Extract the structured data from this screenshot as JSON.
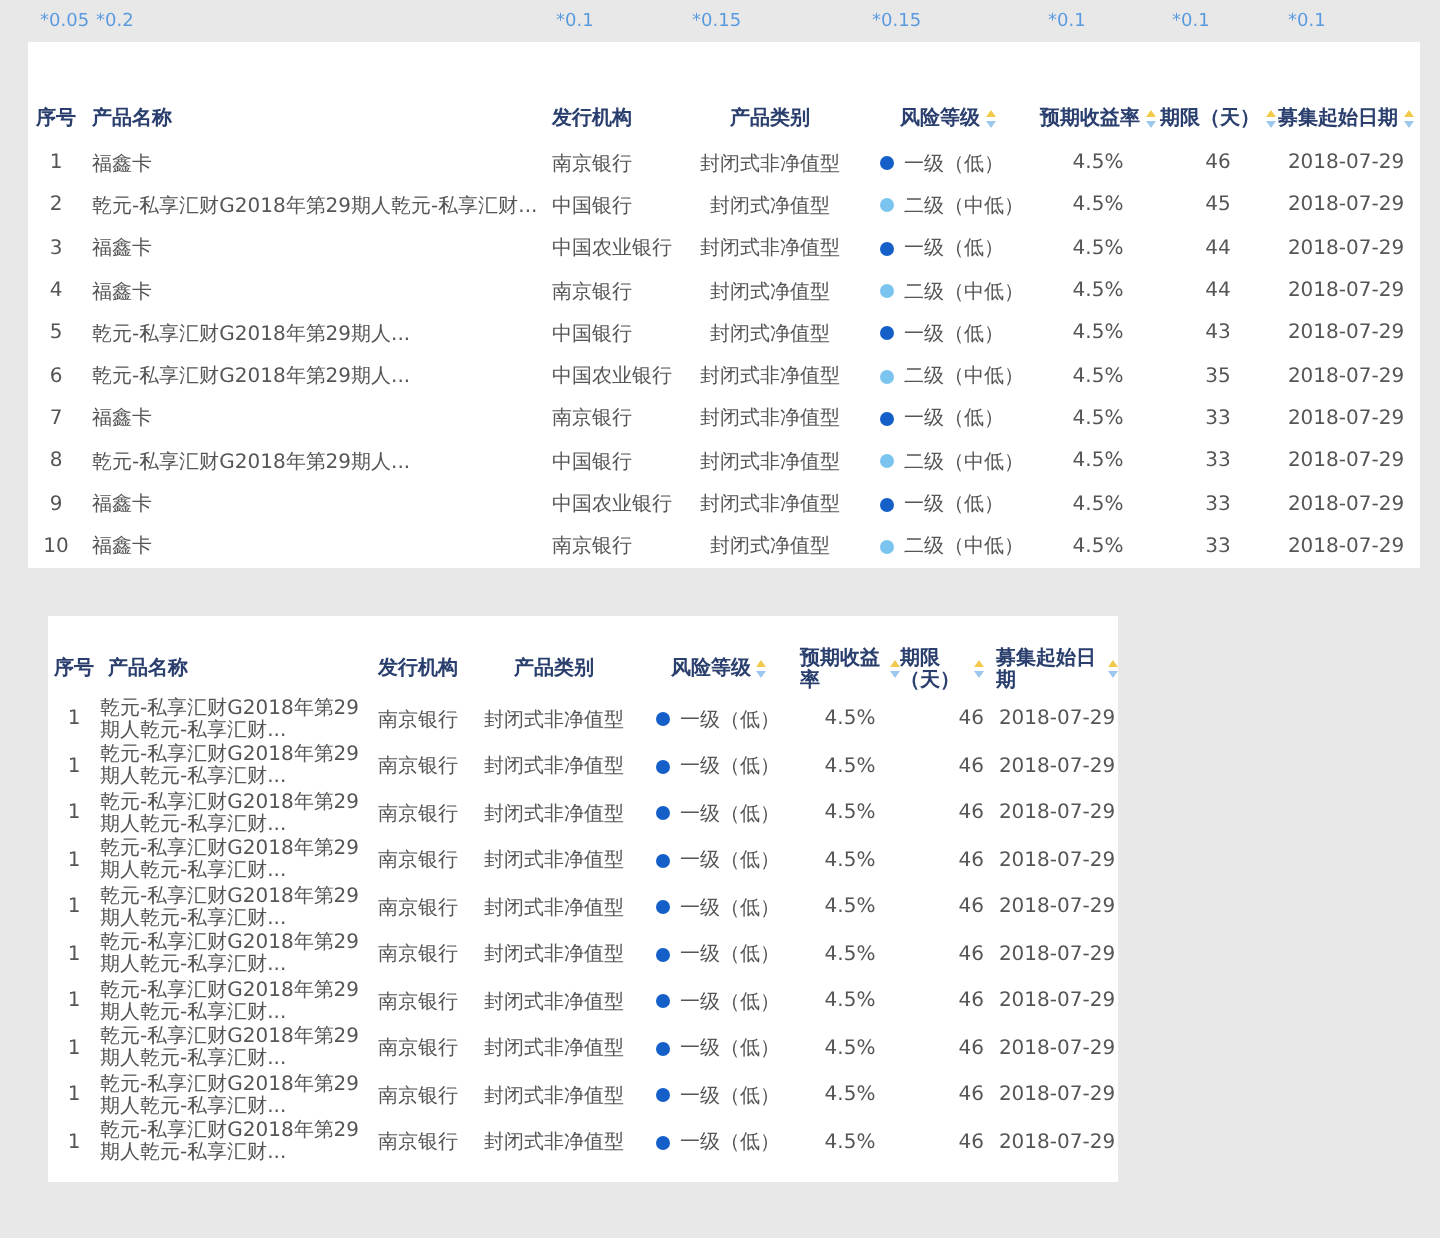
{
  "weights": [
    "*0.05",
    "*0.2",
    "*0.1",
    "*0.15",
    "*0.15",
    "*0.1",
    "*0.1",
    "*0.1"
  ],
  "table": {
    "columns": [
      {
        "label": "序号",
        "sortable": false
      },
      {
        "label": "产品名称",
        "sortable": false
      },
      {
        "label": "发行机构",
        "sortable": false
      },
      {
        "label": "产品类别",
        "sortable": false
      },
      {
        "label": "风险等级",
        "sortable": true
      },
      {
        "label": "预期收益率",
        "sortable": true
      },
      {
        "label": "期限（天）",
        "sortable": true
      },
      {
        "label": "募集起始日期",
        "sortable": true
      }
    ],
    "rows": [
      {
        "index": "1",
        "name": "福鑫卡",
        "issuer": "南京银行",
        "category": "封闭式非净值型",
        "risk": {
          "label": "一级（低）",
          "color": "#1560c8"
        },
        "rate": "4.5%",
        "term": "46",
        "start_date": "2018-07-29"
      },
      {
        "index": "2",
        "name": "乾元-私享汇财G2018年第29期人乾元-私享汇财...",
        "issuer": "中国银行",
        "category": "封闭式净值型",
        "risk": {
          "label": "二级（中低）",
          "color": "#7cc4f0"
        },
        "rate": "4.5%",
        "term": "45",
        "start_date": "2018-07-29"
      },
      {
        "index": "3",
        "name": "福鑫卡",
        "issuer": "中国农业银行",
        "category": "封闭式非净值型",
        "risk": {
          "label": "一级（低）",
          "color": "#1560c8"
        },
        "rate": "4.5%",
        "term": "44",
        "start_date": "2018-07-29"
      },
      {
        "index": "4",
        "name": "福鑫卡",
        "issuer": "南京银行",
        "category": "封闭式净值型",
        "risk": {
          "label": "二级（中低）",
          "color": "#7cc4f0"
        },
        "rate": "4.5%",
        "term": "44",
        "start_date": "2018-07-29"
      },
      {
        "index": "5",
        "name": "乾元-私享汇财G2018年第29期人...",
        "issuer": "中国银行",
        "category": "封闭式净值型",
        "risk": {
          "label": "一级（低）",
          "color": "#1560c8"
        },
        "rate": "4.5%",
        "term": "43",
        "start_date": "2018-07-29"
      },
      {
        "index": "6",
        "name": "乾元-私享汇财G2018年第29期人...",
        "issuer": "中国农业银行",
        "category": "封闭式非净值型",
        "risk": {
          "label": "二级（中低）",
          "color": "#7cc4f0"
        },
        "rate": "4.5%",
        "term": "35",
        "start_date": "2018-07-29"
      },
      {
        "index": "7",
        "name": "福鑫卡",
        "issuer": "南京银行",
        "category": "封闭式非净值型",
        "risk": {
          "label": "一级（低）",
          "color": "#1560c8"
        },
        "rate": "4.5%",
        "term": "33",
        "start_date": "2018-07-29"
      },
      {
        "index": "8",
        "name": "乾元-私享汇财G2018年第29期人...",
        "issuer": "中国银行",
        "category": "封闭式非净值型",
        "risk": {
          "label": "二级（中低）",
          "color": "#7cc4f0"
        },
        "rate": "4.5%",
        "term": "33",
        "start_date": "2018-07-29"
      },
      {
        "index": "9",
        "name": "福鑫卡",
        "issuer": "中国农业银行",
        "category": "封闭式非净值型",
        "risk": {
          "label": "一级（低）",
          "color": "#1560c8"
        },
        "rate": "4.5%",
        "term": "33",
        "start_date": "2018-07-29"
      },
      {
        "index": "10",
        "name": "福鑫卡",
        "issuer": "南京银行",
        "category": "封闭式净值型",
        "risk": {
          "label": "二级（中低）",
          "color": "#7cc4f0"
        },
        "rate": "4.5%",
        "term": "33",
        "start_date": "2018-07-29"
      }
    ]
  },
  "compact_table": {
    "columns": [
      {
        "label": "序号",
        "sortable": false
      },
      {
        "label": "产品名称",
        "sortable": false
      },
      {
        "label": "发行机构",
        "sortable": false
      },
      {
        "label": "产品类别",
        "sortable": false
      },
      {
        "label": "风险等级",
        "sortable": true
      },
      {
        "label": "预期收益率",
        "sortable": true
      },
      {
        "label": "期限（天）",
        "sortable": true
      },
      {
        "label": "募集起始日期",
        "sortable": true
      }
    ],
    "rows": [
      {
        "index": "1",
        "name": "乾元-私享汇财G2018年第29期人乾元-私享汇财...",
        "issuer": "南京银行",
        "category": "封闭式非净值型",
        "risk": {
          "label": "一级（低）",
          "color": "#1560c8"
        },
        "rate": "4.5%",
        "term": "46",
        "start_date": "2018-07-29"
      },
      {
        "index": "1",
        "name": "乾元-私享汇财G2018年第29期人乾元-私享汇财...",
        "issuer": "南京银行",
        "category": "封闭式非净值型",
        "risk": {
          "label": "一级（低）",
          "color": "#1560c8"
        },
        "rate": "4.5%",
        "term": "46",
        "start_date": "2018-07-29"
      },
      {
        "index": "1",
        "name": "乾元-私享汇财G2018年第29期人乾元-私享汇财...",
        "issuer": "南京银行",
        "category": "封闭式非净值型",
        "risk": {
          "label": "一级（低）",
          "color": "#1560c8"
        },
        "rate": "4.5%",
        "term": "46",
        "start_date": "2018-07-29"
      },
      {
        "index": "1",
        "name": "乾元-私享汇财G2018年第29期人乾元-私享汇财...",
        "issuer": "南京银行",
        "category": "封闭式非净值型",
        "risk": {
          "label": "一级（低）",
          "color": "#1560c8"
        },
        "rate": "4.5%",
        "term": "46",
        "start_date": "2018-07-29"
      },
      {
        "index": "1",
        "name": "乾元-私享汇财G2018年第29期人乾元-私享汇财...",
        "issuer": "南京银行",
        "category": "封闭式非净值型",
        "risk": {
          "label": "一级（低）",
          "color": "#1560c8"
        },
        "rate": "4.5%",
        "term": "46",
        "start_date": "2018-07-29"
      },
      {
        "index": "1",
        "name": "乾元-私享汇财G2018年第29期人乾元-私享汇财...",
        "issuer": "南京银行",
        "category": "封闭式非净值型",
        "risk": {
          "label": "一级（低）",
          "color": "#1560c8"
        },
        "rate": "4.5%",
        "term": "46",
        "start_date": "2018-07-29"
      },
      {
        "index": "1",
        "name": "乾元-私享汇财G2018年第29期人乾元-私享汇财...",
        "issuer": "南京银行",
        "category": "封闭式非净值型",
        "risk": {
          "label": "一级（低）",
          "color": "#1560c8"
        },
        "rate": "4.5%",
        "term": "46",
        "start_date": "2018-07-29"
      },
      {
        "index": "1",
        "name": "乾元-私享汇财G2018年第29期人乾元-私享汇财...",
        "issuer": "南京银行",
        "category": "封闭式非净值型",
        "risk": {
          "label": "一级（低）",
          "color": "#1560c8"
        },
        "rate": "4.5%",
        "term": "46",
        "start_date": "2018-07-29"
      },
      {
        "index": "1",
        "name": "乾元-私享汇财G2018年第29期人乾元-私享汇财...",
        "issuer": "南京银行",
        "category": "封闭式非净值型",
        "risk": {
          "label": "一级（低）",
          "color": "#1560c8"
        },
        "rate": "4.5%",
        "term": "46",
        "start_date": "2018-07-29"
      },
      {
        "index": "1",
        "name": "乾元-私享汇财G2018年第29期人乾元-私享汇财...",
        "issuer": "南京银行",
        "category": "封闭式非净值型",
        "risk": {
          "label": "一级（低）",
          "color": "#1560c8"
        },
        "rate": "4.5%",
        "term": "46",
        "start_date": "2018-07-29"
      }
    ]
  }
}
